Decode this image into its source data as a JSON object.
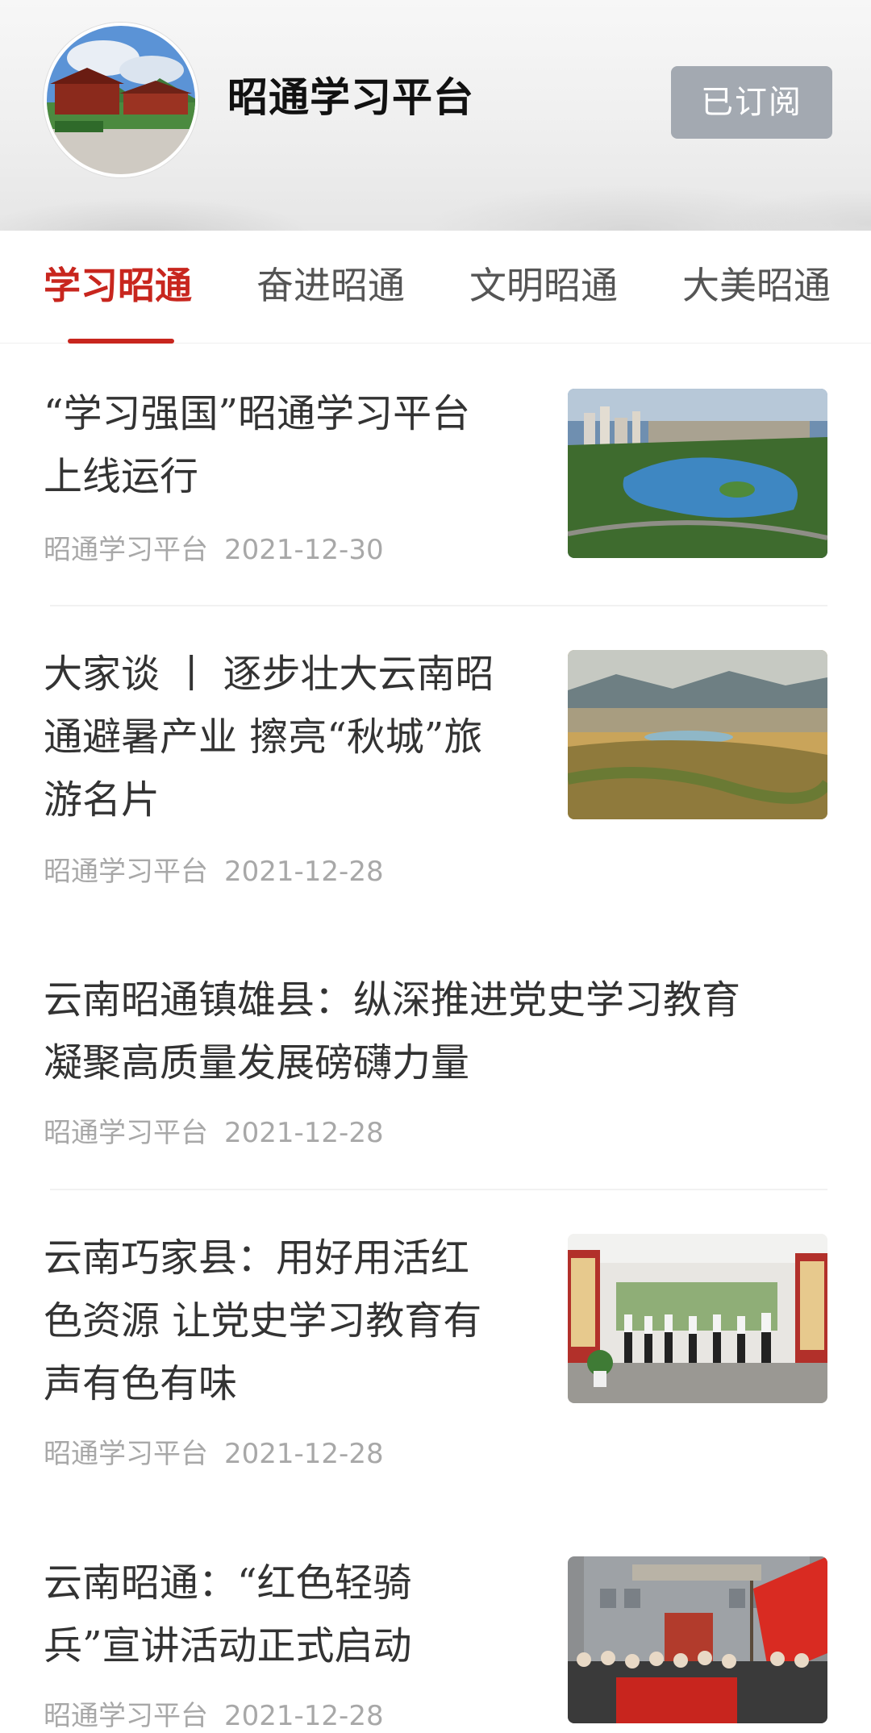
{
  "header": {
    "channel_name": "昭通学习平台",
    "subscribe_label": "已订阅"
  },
  "tabs": [
    {
      "label": "学习昭通",
      "active": true
    },
    {
      "label": "奋进昭通",
      "active": false
    },
    {
      "label": "文明昭通",
      "active": false
    },
    {
      "label": "大美昭通",
      "active": false
    }
  ],
  "articles": [
    {
      "title_lines": [
        "“学习强国”昭通学习平台",
        "上线运行"
      ],
      "source": "昭通学习平台",
      "date": "2021-12-30",
      "has_image": true
    },
    {
      "title_lines": [
        "大家谈 丨 逐步壮大云南昭",
        "通避暑产业 擦亮“秋城”旅",
        "游名片"
      ],
      "source": "昭通学习平台",
      "date": "2021-12-28",
      "has_image": true
    },
    {
      "title_lines": [
        "云南昭通镇雄县：纵深推进党史学习教育",
        "凝聚高质量发展磅礴力量"
      ],
      "source": "昭通学习平台",
      "date": "2021-12-28",
      "has_image": false
    },
    {
      "title_lines": [
        "云南巧家县：用好用活红",
        "色资源 让党史学习教育有",
        "声有色有味"
      ],
      "source": "昭通学习平台",
      "date": "2021-12-28",
      "has_image": true
    },
    {
      "title_lines": [
        "云南昭通：“红色轻骑",
        "兵”宣讲活动正式启动"
      ],
      "source": "昭通学习平台",
      "date": "2021-12-28",
      "has_image": true
    }
  ],
  "colors": {
    "accent": "#c8261e",
    "tab_inactive": "#555555",
    "meta_text": "#a8a8a8",
    "subscribed_button": "#a3a9b1"
  }
}
